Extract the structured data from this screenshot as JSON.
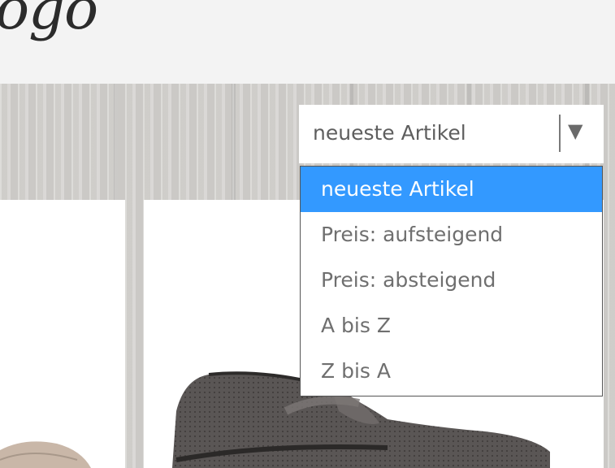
{
  "header": {
    "logo_text": "ogo"
  },
  "sort": {
    "selected_label": "neueste Artikel",
    "arrow_icon": "triangle-down-icon",
    "options": [
      {
        "label": "neueste Artikel",
        "selected": true
      },
      {
        "label": "Preis: aufsteigend",
        "selected": false
      },
      {
        "label": "Preis: absteigend",
        "selected": false
      },
      {
        "label": "A bis Z",
        "selected": false
      },
      {
        "label": "Z bis A",
        "selected": false
      }
    ]
  },
  "colors": {
    "selected_option_bg": "#3399ff",
    "option_text": "#6f6f6f",
    "page_bg": "#f3f3f3"
  }
}
